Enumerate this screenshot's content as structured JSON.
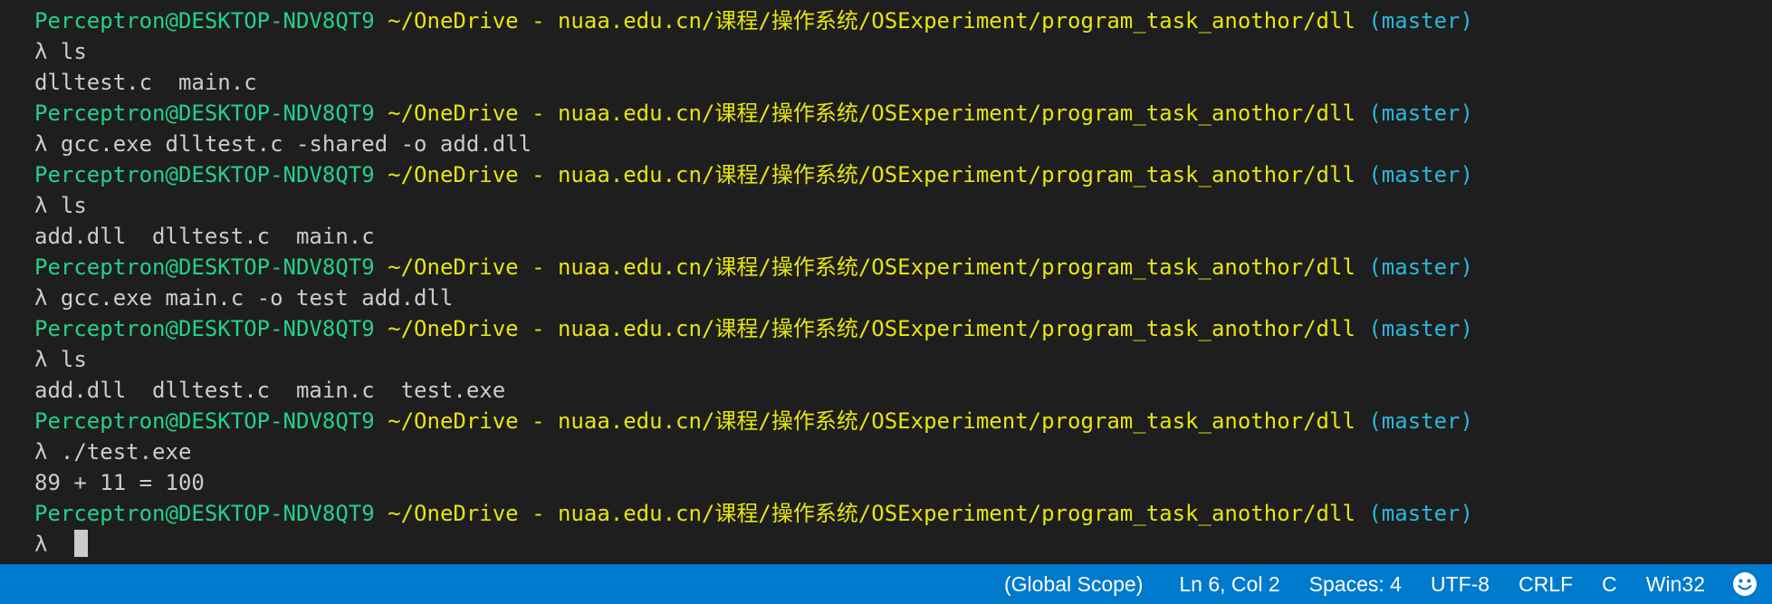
{
  "terminal": {
    "prompt": {
      "user": "Perceptron@DESKTOP-NDV8QT9",
      "path": "~/OneDrive - nuaa.edu.cn/课程/操作系统/OSExperiment/program_task_anothor/dll",
      "branch": "(master)",
      "symbol": "λ"
    },
    "commands": {
      "c1": "ls",
      "c2": "gcc.exe dlltest.c -shared -o add.dll",
      "c3": "ls",
      "c4": "gcc.exe main.c -o test add.dll",
      "c5": "ls",
      "c6": "./test.exe"
    },
    "outputs": {
      "o1": "dlltest.c  main.c",
      "o3": "add.dll  dlltest.c  main.c",
      "o5": "add.dll  dlltest.c  main.c  test.exe",
      "o6": "89 + 11 = 100"
    }
  },
  "statusbar": {
    "scope": "(Global Scope)",
    "position": "Ln 6, Col 2",
    "spaces": "Spaces: 4",
    "encoding": "UTF-8",
    "line_ending": "CRLF",
    "language": "C",
    "platform": "Win32",
    "feedback_icon": "smiley-feedback-icon"
  },
  "colors": {
    "background": "#1e1e1e",
    "user": "#23d18b",
    "path": "#e5e510",
    "branch": "#29b8db",
    "text": "#cccccc",
    "statusbar": "#007acc"
  }
}
